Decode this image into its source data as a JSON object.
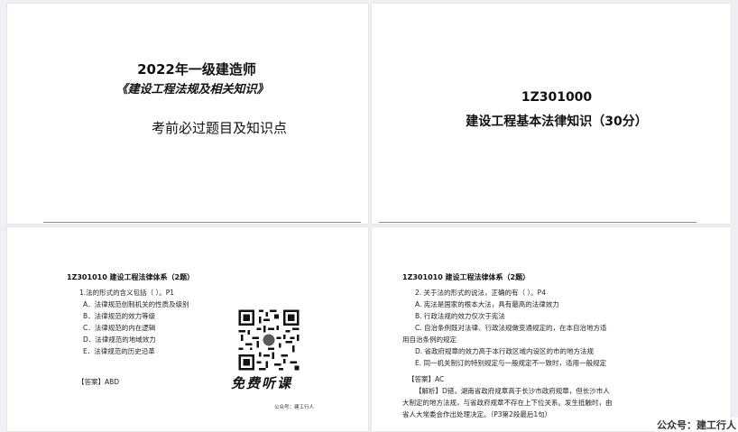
{
  "cover": {
    "year_title": "2022年一级建造师",
    "book_title": "《建设工程法规及相关知识》",
    "subtitle": "考前必过题目及知识点"
  },
  "part": {
    "code": "1Z301000",
    "title": "建设工程基本法律知识（30分）"
  },
  "page_left": {
    "section": "1Z301010 建设工程法律体系（2题）",
    "question": "1.法的形式的含义包括（    ）。P1",
    "options": [
      "A．法律规范创制机关的性质及级别",
      "B．法律规范的效力等级",
      "C．法律规范的内在逻辑",
      "D．法律规范的地域效力",
      "E．法律规范的历史沿革"
    ],
    "answer": "【答案】ABD",
    "promo_text": "免费听课",
    "credit": "公众号：建工行人"
  },
  "page_right": {
    "section": "1Z301010 建设工程法律体系（2题）",
    "question": "2. 关于法的形式的说法，正确的有（    ）。P4",
    "options": [
      "A. 宪法是国家的根本大法，具有最高的法律效力",
      "B. 行政法规的效力仅次于宪法",
      "C. 自治条例既对法律、行政法规做变通规定的，在本自治地方适",
      "用自治条例的规定",
      "D. 省政府规章的效力高于本行政区域内设区的市的地方法规",
      "E. 同一机关制订的特别规定与一般规定不一致时，适用一般规定"
    ],
    "answer": "【答案】AC",
    "explanation": [
      "【解析】D错，湖南省政府规章高于长沙市政府规章，但长沙市人",
      "大制定的地方法规，与省政府规章不存在上下位关系。发生抵触时，由",
      "省人大常委会作出处理决定。（P3第2段最后1句）"
    ]
  },
  "watermark": "公众号：建工行人"
}
